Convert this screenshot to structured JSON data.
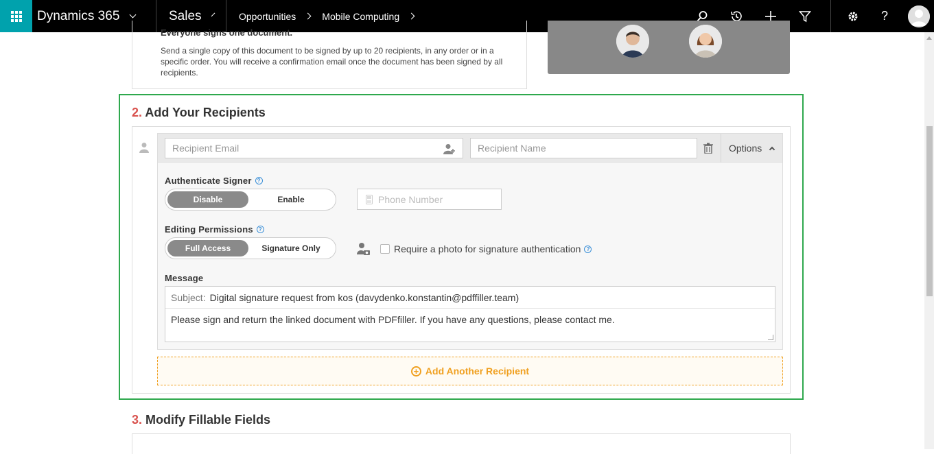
{
  "nav": {
    "app_name": "Dynamics 365",
    "module": "Sales",
    "breadcrumbs": [
      "Opportunities",
      "Mobile Computing"
    ]
  },
  "section1": {
    "title": "Everyone signs one document.",
    "description": "Send a single copy of this document to be signed by up to 20 recipients, in any order or in a specific order. You will receive a confirmation email once the document has been signed by all recipients."
  },
  "section2": {
    "number": "2.",
    "title": "Add Your Recipients",
    "recipient_email_placeholder": "Recipient Email",
    "recipient_name_placeholder": "Recipient Name",
    "options_label": "Options",
    "authenticate_label": "Authenticate Signer",
    "auth_options": [
      "Disable",
      "Enable"
    ],
    "auth_selected": "Disable",
    "phone_placeholder": "Phone Number",
    "editing_label": "Editing Permissions",
    "editing_options": [
      "Full Access",
      "Signature Only"
    ],
    "editing_selected": "Full Access",
    "photo_label": "Require a photo for signature authentication",
    "message_label": "Message",
    "subject_label": "Subject:",
    "subject_value": "Digital signature request from kos (davydenko.konstantin@pdffiller.team)",
    "message_body": "Please sign and return the linked document with PDFfiller. If you have any questions, please contact me.",
    "add_another": "Add Another Recipient"
  },
  "section3": {
    "number": "3.",
    "title": "Modify Fillable Fields"
  },
  "colors": {
    "nav_bg": "#000000",
    "waffle_bg": "#00a2ad",
    "highlight_border": "#2ea84d",
    "section_number": "#d9534f",
    "add_recipient": "#f0a020"
  }
}
